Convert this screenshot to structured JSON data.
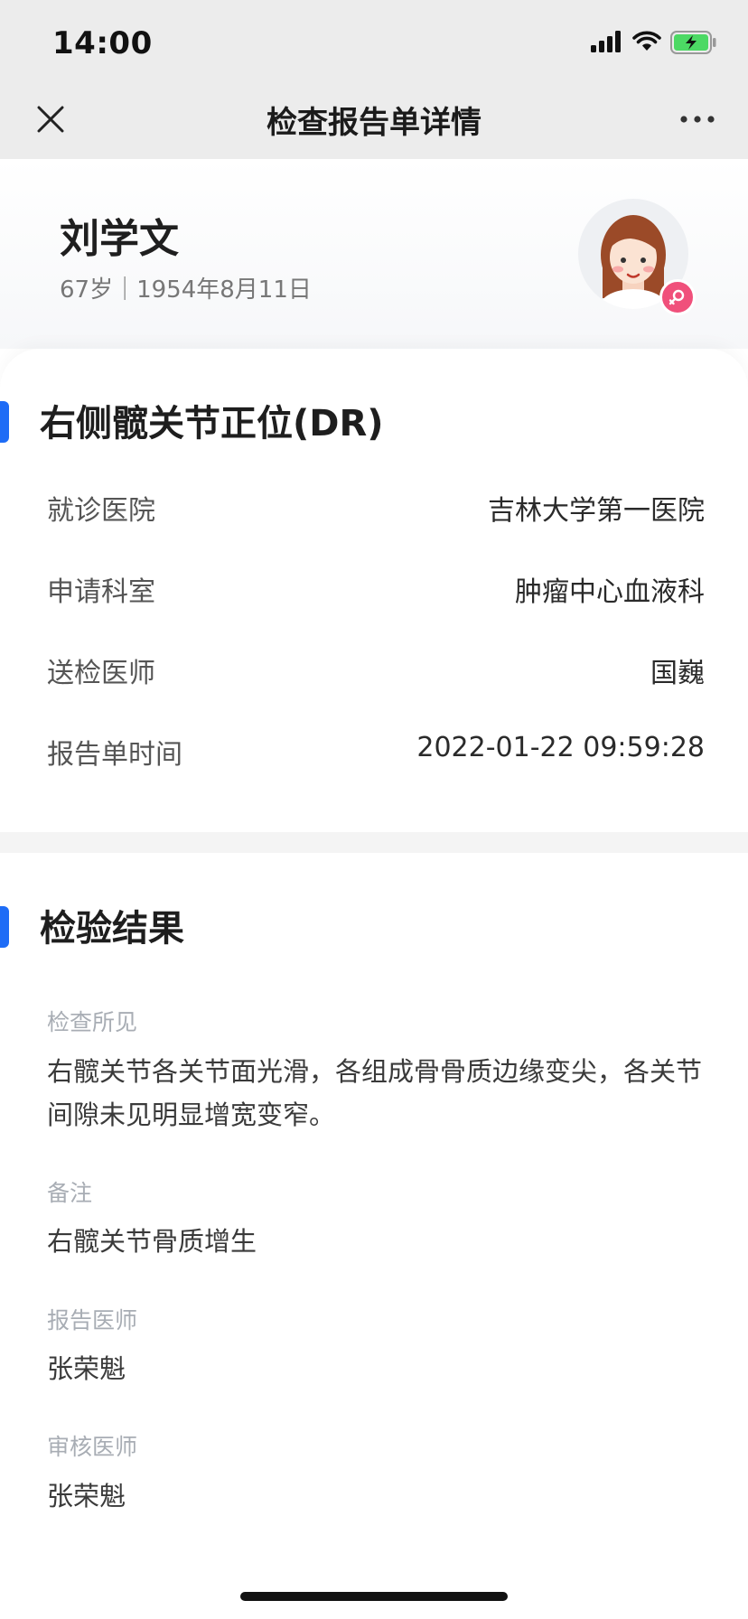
{
  "status_bar": {
    "time": "14:00"
  },
  "nav": {
    "title": "检查报告单详情"
  },
  "patient": {
    "name": "刘学文",
    "info": "67岁｜1954年8月11日",
    "gender": "female"
  },
  "report": {
    "title": "右侧髋关节正位(DR)",
    "rows": [
      {
        "label": "就诊医院",
        "value": "吉林大学第一医院"
      },
      {
        "label": "申请科室",
        "value": "肿瘤中心血液科"
      },
      {
        "label": "送检医师",
        "value": "国巍"
      },
      {
        "label": "报告单时间",
        "value": "2022-01-22 09:59:28"
      }
    ]
  },
  "result": {
    "title": "检验结果",
    "fields": [
      {
        "label": "检查所见",
        "value": "右髋关节各关节面光滑，各组成骨骨质边缘变尖，各关节间隙未见明显增宽变窄。"
      },
      {
        "label": "备注",
        "value": "右髋关节骨质增生"
      },
      {
        "label": "报告医师",
        "value": "张荣魁"
      },
      {
        "label": "审核医师",
        "value": "张荣魁"
      }
    ]
  },
  "colors": {
    "accent": "#1e6cf6",
    "gender_badge": "#f0507b",
    "battery": "#4cd964"
  }
}
